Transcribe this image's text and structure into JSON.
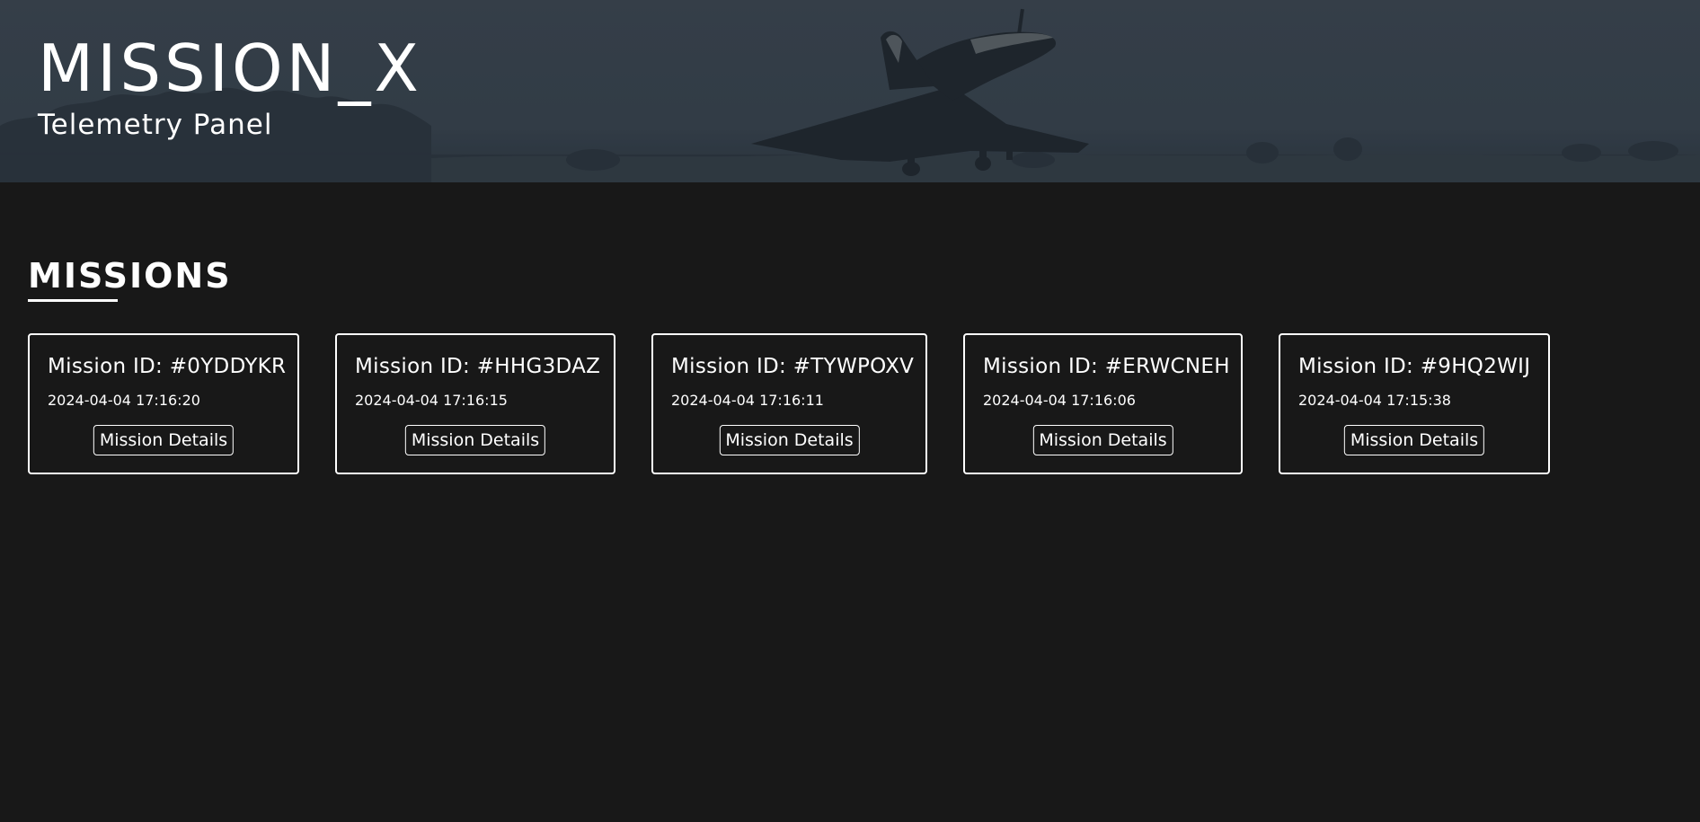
{
  "header": {
    "title": "MISSION_X",
    "subtitle": "Telemetry Panel",
    "background_color": "#36404a"
  },
  "missions_section": {
    "title": "MISSIONS",
    "accent_color": "#ffffff",
    "background_color": "#181818"
  },
  "missions": [
    {
      "id_label": "Mission ID: #0YDDYKR",
      "timestamp": "2024-04-04 17:16:20",
      "button_label": "Mission Details"
    },
    {
      "id_label": "Mission ID: #HHG3DAZ",
      "timestamp": "2024-04-04 17:16:15",
      "button_label": "Mission Details"
    },
    {
      "id_label": "Mission ID: #TYWPOXV",
      "timestamp": "2024-04-04 17:16:11",
      "button_label": "Mission Details"
    },
    {
      "id_label": "Mission ID: #ERWCNEH",
      "timestamp": "2024-04-04 17:16:06",
      "button_label": "Mission Details"
    },
    {
      "id_label": "Mission ID: #9HQ2WIJ",
      "timestamp": "2024-04-04 17:15:38",
      "button_label": "Mission Details"
    }
  ]
}
